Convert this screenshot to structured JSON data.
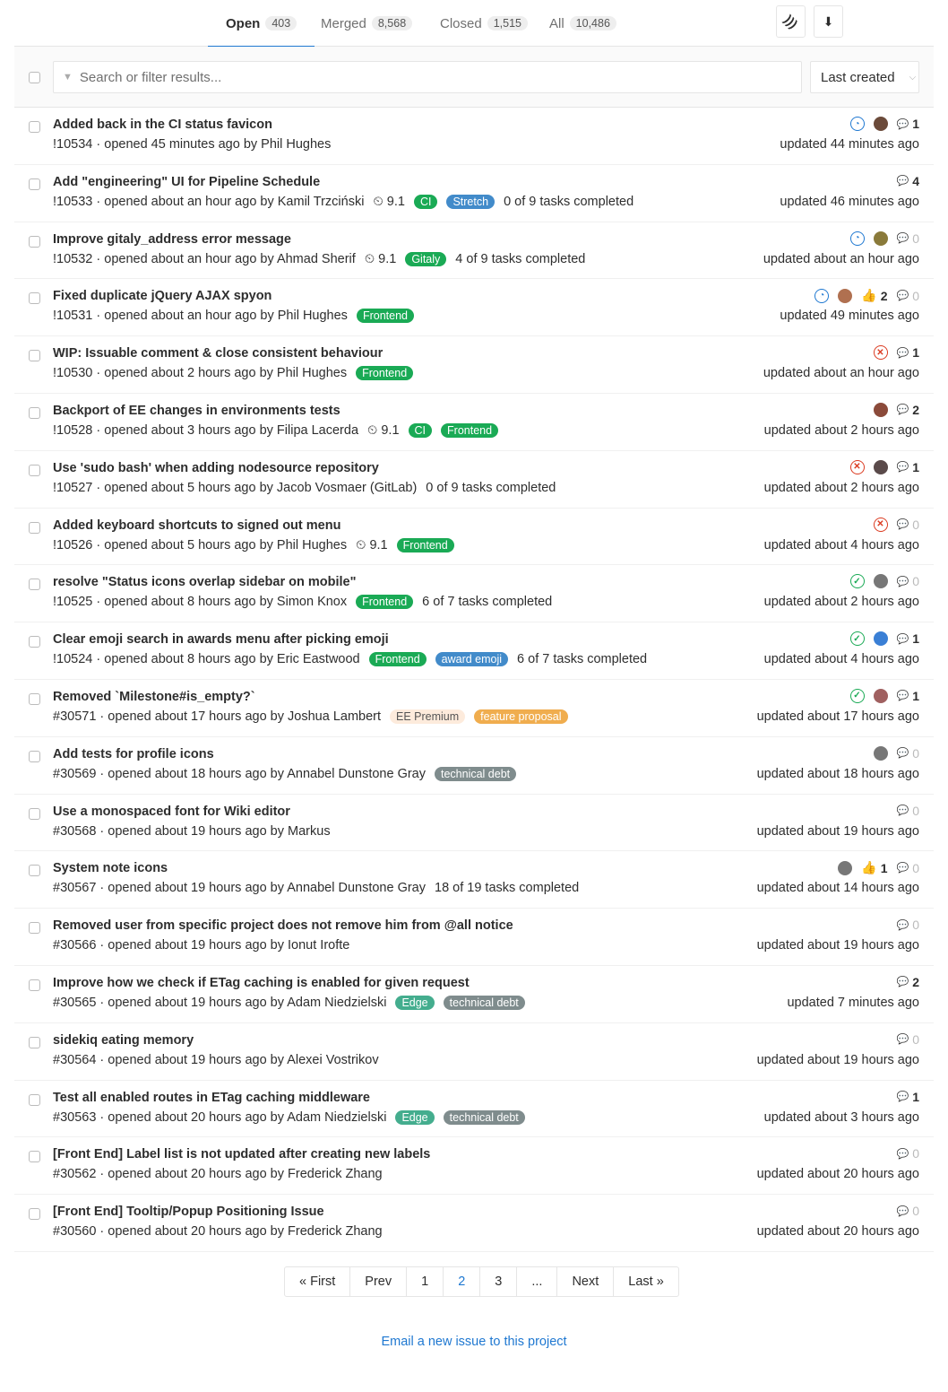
{
  "tabs": [
    {
      "label": "Open",
      "count": "403"
    },
    {
      "label": "Merged",
      "count": "8,568"
    },
    {
      "label": "Closed",
      "count": "1,515"
    },
    {
      "label": "All",
      "count": "10,486"
    }
  ],
  "icons": {
    "rss": "rss-icon",
    "download": "download-icon"
  },
  "search": {
    "placeholder": "Search or filter results..."
  },
  "sort": {
    "label": "Last created"
  },
  "colors": {
    "accent": "#1f78d1",
    "running": "#1f78d1",
    "failed": "#db3b21",
    "success": "#1aaa55"
  },
  "rows": [
    {
      "title": "Added back in the CI status favicon",
      "ref": "!10534",
      "opened": "opened 45 minutes ago by Phil Hughes",
      "milestone": "",
      "labels": [],
      "tasks": "",
      "status": "running",
      "avatar": "#6b4a3a",
      "upvotes": "",
      "comments": "1",
      "updated": "updated 44 minutes ago"
    },
    {
      "title": "Add \"engineering\" UI for Pipeline Schedule",
      "ref": "!10533",
      "opened": "opened about an hour ago by Kamil Trzciński",
      "milestone": "9.1",
      "labels": [
        {
          "t": "CI",
          "c": "#1aaa55"
        },
        {
          "t": "Stretch",
          "c": "#428bca"
        }
      ],
      "tasks": "0 of 9 tasks completed",
      "status": "",
      "avatar": "",
      "upvotes": "",
      "comments": "4",
      "updated": "updated 46 minutes ago"
    },
    {
      "title": "Improve gitaly_address error message",
      "ref": "!10532",
      "opened": "opened about an hour ago by Ahmad Sherif",
      "milestone": "9.1",
      "labels": [
        {
          "t": "Gitaly",
          "c": "#1aaa55"
        }
      ],
      "tasks": "4 of 9 tasks completed",
      "status": "running",
      "avatar": "#8a7a3a",
      "upvotes": "",
      "comments": "0",
      "updated": "updated about an hour ago"
    },
    {
      "title": "Fixed duplicate jQuery AJAX spyon",
      "ref": "!10531",
      "opened": "opened about an hour ago by Phil Hughes",
      "milestone": "",
      "labels": [
        {
          "t": "Frontend",
          "c": "#1aaa55"
        }
      ],
      "tasks": "",
      "status": "running",
      "avatar": "#b07050",
      "upvotes": "2",
      "comments": "0",
      "updated": "updated 49 minutes ago"
    },
    {
      "title": "WIP: Issuable comment & close consistent behaviour",
      "ref": "!10530",
      "opened": "opened about 2 hours ago by Phil Hughes",
      "milestone": "",
      "labels": [
        {
          "t": "Frontend",
          "c": "#1aaa55"
        }
      ],
      "tasks": "",
      "status": "failed",
      "avatar": "",
      "upvotes": "",
      "comments": "1",
      "updated": "updated about an hour ago"
    },
    {
      "title": "Backport of EE changes in environments tests",
      "ref": "!10528",
      "opened": "opened about 3 hours ago by Filipa Lacerda",
      "milestone": "9.1",
      "labels": [
        {
          "t": "CI",
          "c": "#1aaa55"
        },
        {
          "t": "Frontend",
          "c": "#1aaa55"
        }
      ],
      "tasks": "",
      "status": "",
      "avatar": "#8b4a3a",
      "upvotes": "",
      "comments": "2",
      "updated": "updated about 2 hours ago"
    },
    {
      "title": "Use 'sudo bash' when adding nodesource repository",
      "ref": "!10527",
      "opened": "opened about 5 hours ago by Jacob Vosmaer (GitLab)",
      "milestone": "",
      "labels": [],
      "tasks": "0 of 9 tasks completed",
      "status": "failed",
      "avatar": "#5a4a4a",
      "upvotes": "",
      "comments": "1",
      "updated": "updated about 2 hours ago"
    },
    {
      "title": "Added keyboard shortcuts to signed out menu",
      "ref": "!10526",
      "opened": "opened about 5 hours ago by Phil Hughes",
      "milestone": "9.1",
      "labels": [
        {
          "t": "Frontend",
          "c": "#1aaa55"
        }
      ],
      "tasks": "",
      "status": "failed",
      "avatar": "",
      "upvotes": "",
      "comments": "0",
      "updated": "updated about 4 hours ago"
    },
    {
      "title": "resolve \"Status icons overlap sidebar on mobile\"",
      "ref": "!10525",
      "opened": "opened about 8 hours ago by Simon Knox",
      "milestone": "",
      "labels": [
        {
          "t": "Frontend",
          "c": "#1aaa55"
        }
      ],
      "tasks": "6 of 7 tasks completed",
      "status": "success",
      "avatar": "#777",
      "upvotes": "",
      "comments": "0",
      "updated": "updated about 2 hours ago"
    },
    {
      "title": "Clear emoji search in awards menu after picking emoji",
      "ref": "!10524",
      "opened": "opened about 8 hours ago by Eric Eastwood",
      "milestone": "",
      "labels": [
        {
          "t": "Frontend",
          "c": "#1aaa55"
        },
        {
          "t": "award emoji",
          "c": "#428bca"
        }
      ],
      "tasks": "6 of 7 tasks completed",
      "status": "success",
      "avatar": "#3a7fd5",
      "upvotes": "",
      "comments": "1",
      "updated": "updated about 4 hours ago"
    },
    {
      "title": "Removed `Milestone#is_empty?`",
      "ref": "#30571",
      "opened": "opened about 17 hours ago by Joshua Lambert",
      "milestone": "",
      "labels": [
        {
          "t": "EE Premium",
          "c": "#fdebdc",
          "tc": "#555"
        },
        {
          "t": "feature proposal",
          "c": "#f0ad4e"
        }
      ],
      "tasks": "",
      "status": "success",
      "avatar": "#a06060",
      "upvotes": "",
      "comments": "1",
      "updated": "updated about 17 hours ago"
    },
    {
      "title": "Add tests for profile icons",
      "ref": "#30569",
      "opened": "opened about 18 hours ago by Annabel Dunstone Gray",
      "milestone": "",
      "labels": [
        {
          "t": "technical debt",
          "c": "#7f8c8d"
        }
      ],
      "tasks": "",
      "status": "",
      "avatar": "#777",
      "upvotes": "",
      "comments": "0",
      "updated": "updated about 18 hours ago"
    },
    {
      "title": "Use a monospaced font for Wiki editor",
      "ref": "#30568",
      "opened": "opened about 19 hours ago by Markus",
      "milestone": "",
      "labels": [],
      "tasks": "",
      "status": "",
      "avatar": "",
      "upvotes": "",
      "comments": "0",
      "updated": "updated about 19 hours ago"
    },
    {
      "title": "System note icons",
      "ref": "#30567",
      "opened": "opened about 19 hours ago by Annabel Dunstone Gray",
      "milestone": "",
      "labels": [],
      "tasks": "18 of 19 tasks completed",
      "status": "",
      "avatar": "#777",
      "upvotes": "1",
      "comments": "0",
      "updated": "updated about 14 hours ago"
    },
    {
      "title": "Removed user from specific project does not remove him from @all notice",
      "ref": "#30566",
      "opened": "opened about 19 hours ago by Ionut Irofte",
      "milestone": "",
      "labels": [],
      "tasks": "",
      "status": "",
      "avatar": "",
      "upvotes": "",
      "comments": "0",
      "updated": "updated about 19 hours ago"
    },
    {
      "title": "Improve how we check if ETag caching is enabled for given request",
      "ref": "#30565",
      "opened": "opened about 19 hours ago by Adam Niedzielski",
      "milestone": "",
      "labels": [
        {
          "t": "Edge",
          "c": "#44ad8e"
        },
        {
          "t": "technical debt",
          "c": "#7f8c8d"
        }
      ],
      "tasks": "",
      "status": "",
      "avatar": "",
      "upvotes": "",
      "comments": "2",
      "updated": "updated 7 minutes ago"
    },
    {
      "title": "sidekiq eating memory",
      "ref": "#30564",
      "opened": "opened about 19 hours ago by Alexei Vostrikov",
      "milestone": "",
      "labels": [],
      "tasks": "",
      "status": "",
      "avatar": "",
      "upvotes": "",
      "comments": "0",
      "updated": "updated about 19 hours ago"
    },
    {
      "title": "Test all enabled routes in ETag caching middleware",
      "ref": "#30563",
      "opened": "opened about 20 hours ago by Adam Niedzielski",
      "milestone": "",
      "labels": [
        {
          "t": "Edge",
          "c": "#44ad8e"
        },
        {
          "t": "technical debt",
          "c": "#7f8c8d"
        }
      ],
      "tasks": "",
      "status": "",
      "avatar": "",
      "upvotes": "",
      "comments": "1",
      "updated": "updated about 3 hours ago"
    },
    {
      "title": "[Front End] Label list is not updated after creating new labels",
      "ref": "#30562",
      "opened": "opened about 20 hours ago by Frederick Zhang",
      "milestone": "",
      "labels": [],
      "tasks": "",
      "status": "",
      "avatar": "",
      "upvotes": "",
      "comments": "0",
      "updated": "updated about 20 hours ago"
    },
    {
      "title": "[Front End] Tooltip/Popup Positioning Issue",
      "ref": "#30560",
      "opened": "opened about 20 hours ago by Frederick Zhang",
      "milestone": "",
      "labels": [],
      "tasks": "",
      "status": "",
      "avatar": "",
      "upvotes": "",
      "comments": "0",
      "updated": "updated about 20 hours ago"
    }
  ],
  "pagination": [
    "« First",
    "Prev",
    "1",
    "2",
    "3",
    "...",
    "Next",
    "Last »"
  ],
  "pagination_active": "2",
  "footer": {
    "email_link": "Email a new issue to this project"
  }
}
